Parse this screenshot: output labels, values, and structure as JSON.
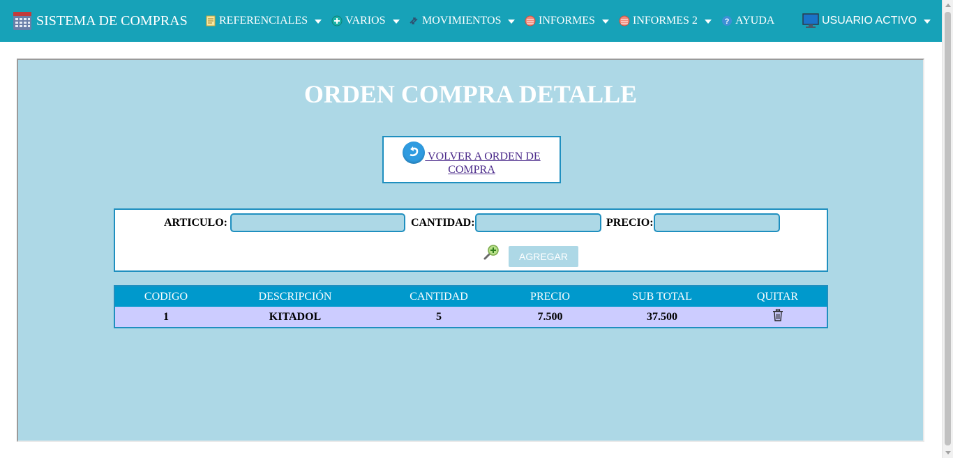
{
  "navbar": {
    "brand": "SISTEMA DE COMPRAS",
    "items": [
      {
        "label": "REFERENCIALES",
        "icon": "notepad-icon"
      },
      {
        "label": "VARIOS",
        "icon": "plus-circle-icon"
      },
      {
        "label": "MOVIMIENTOS",
        "icon": "arrows-exchange-icon"
      },
      {
        "label": "INFORMES",
        "icon": "report-icon"
      },
      {
        "label": "INFORMES 2",
        "icon": "report-icon"
      },
      {
        "label": "AYUDA",
        "icon": "help-icon"
      }
    ],
    "user": "USUARIO ACTIVO",
    "colors": {
      "bar": "#17a2b8"
    }
  },
  "page": {
    "title": "ORDEN COMPRA DETALLE",
    "back_link": "VOLVER A ORDEN DE COMPRA"
  },
  "form": {
    "articulo_label": "ARTICULO:",
    "cantidad_label": "CANTIDAD:",
    "precio_label": "PRECIO:",
    "articulo_value": "",
    "cantidad_value": "",
    "precio_value": "",
    "add_button": "AGREGAR"
  },
  "table": {
    "headers": [
      "CODIGO",
      "DESCRIPCIÓN",
      "CANTIDAD",
      "PRECIO",
      "SUB TOTAL",
      "QUITAR"
    ],
    "rows": [
      {
        "codigo": "1",
        "descripcion": "KITADOL",
        "cantidad": "5",
        "precio": "7.500",
        "subtotal": "37.500"
      }
    ]
  },
  "colors": {
    "panel_bg": "#add8e6",
    "border": "#1f8fbf",
    "table_header": "#0099cc",
    "table_row": "#ccccff"
  }
}
